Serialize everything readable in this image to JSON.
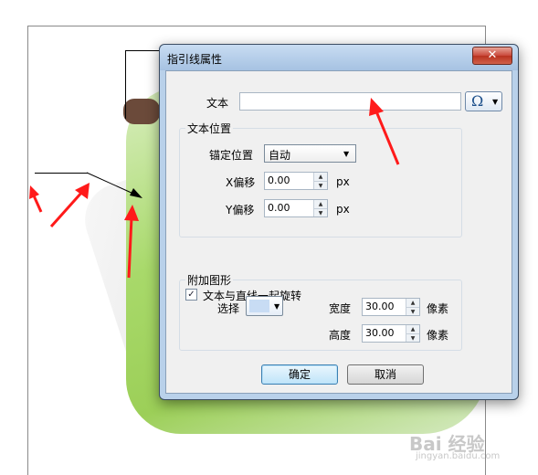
{
  "dialog": {
    "title": "指引线属性",
    "close_glyph": "✕",
    "text_label": "文本",
    "text_value": "",
    "omega_glyph": "Ω",
    "dropdown_arrow": "▼",
    "position_group": {
      "title": "文本位置",
      "anchor_label": "锚定位置",
      "anchor_value": "自动",
      "x_label": "X偏移",
      "x_value": "0.00",
      "y_label": "Y偏移",
      "y_value": "0.00",
      "unit": "px"
    },
    "rotate_checkbox": {
      "label": "文本与直线一起旋转",
      "checked": true,
      "mark": "✓"
    },
    "shape_group": {
      "title": "附加图形",
      "select_label": "选择",
      "width_label": "宽度",
      "width_value": "30.00",
      "height_label": "高度",
      "height_value": "30.00",
      "unit": "像素"
    },
    "ok_label": "确定",
    "cancel_label": "取消"
  },
  "spin_up": "▲",
  "spin_down": "▼",
  "watermark": {
    "text": "Bai 经验",
    "sub": "jingyan.baidu.com"
  },
  "colors": {
    "arrow": "#ff1a1a",
    "title_bar": "#b9d1ea",
    "accent_swatch": "#c8dcf4"
  }
}
